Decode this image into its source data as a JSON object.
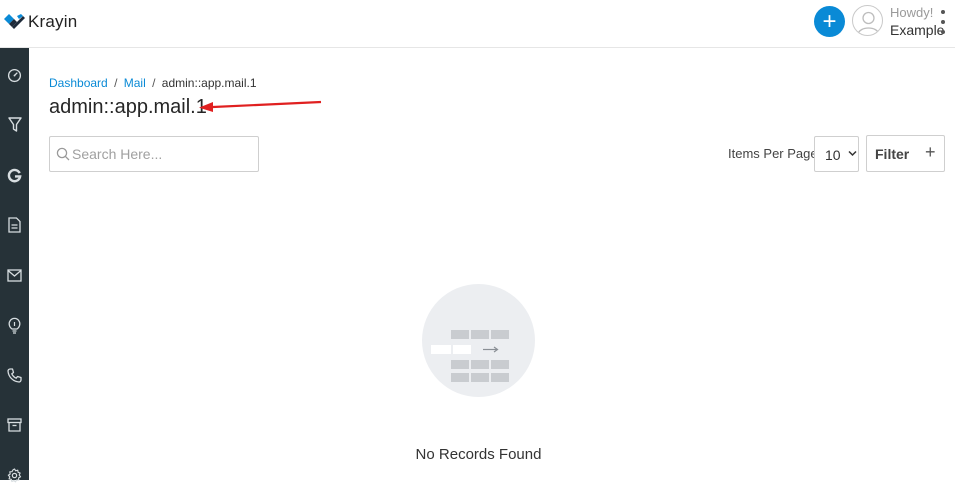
{
  "header": {
    "logo_text": "Krayin",
    "greeting": "Howdy!",
    "user_name": "Example",
    "icons": [
      "logo-icon",
      "plus-icon",
      "avatar-icon",
      "more-vertical-icon"
    ],
    "accent_color": "#0a8ad6"
  },
  "sidebar": {
    "background": "#263238",
    "items": [
      {
        "name": "dashboard",
        "icon": "gauge-icon"
      },
      {
        "name": "leads",
        "icon": "funnel-icon"
      },
      {
        "name": "google",
        "icon": "google-icon"
      },
      {
        "name": "quotes",
        "icon": "document-icon"
      },
      {
        "name": "mail",
        "icon": "mail-icon"
      },
      {
        "name": "activities",
        "icon": "lightbulb-icon"
      },
      {
        "name": "contacts",
        "icon": "phone-icon"
      },
      {
        "name": "products",
        "icon": "archive-icon"
      },
      {
        "name": "settings",
        "icon": "gear-icon"
      }
    ]
  },
  "breadcrumb": {
    "items": [
      "Dashboard",
      "Mail",
      "admin::app.mail.1"
    ],
    "separator": "/"
  },
  "page": {
    "title": "admin::app.mail.1"
  },
  "toolbar": {
    "search_placeholder": "Search Here...",
    "items_per_page_label": "Items Per Page",
    "items_per_page_value": "10",
    "filter_label": "Filter",
    "filter_icon": "+"
  },
  "empty_state": {
    "message": "No Records Found",
    "icon": "empty-table-icon"
  },
  "annotation": {
    "color": "#e02020",
    "icon": "red-arrow-annotation"
  }
}
